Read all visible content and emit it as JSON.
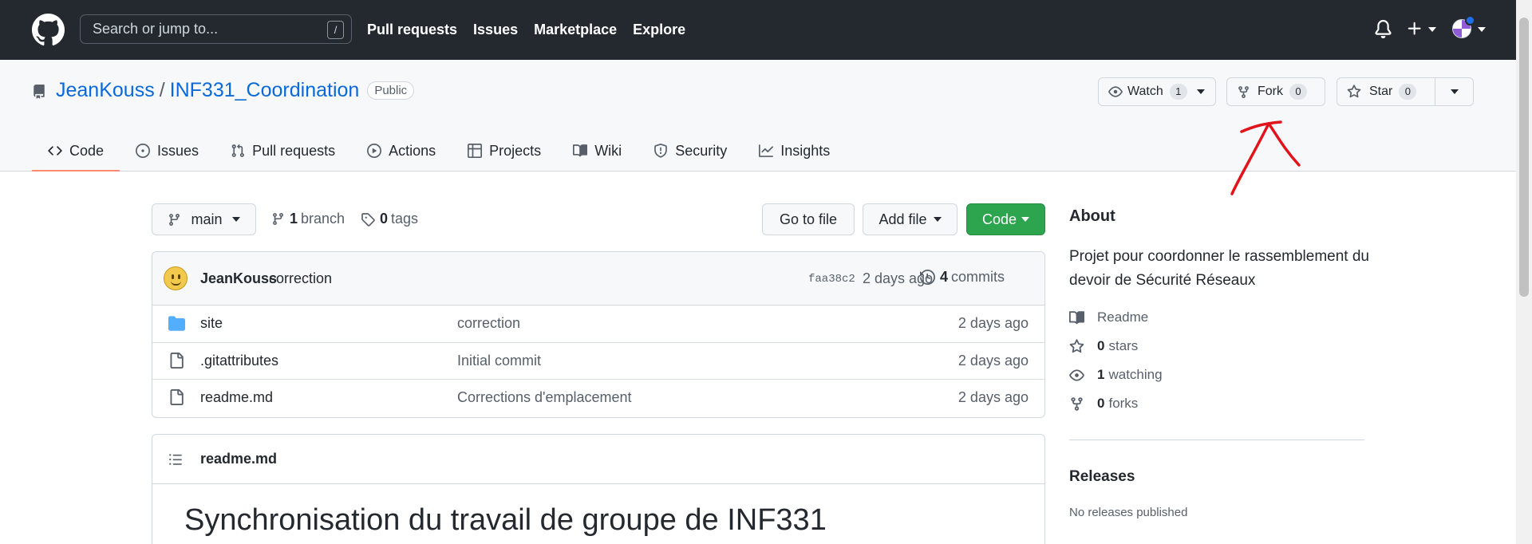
{
  "topbar": {
    "search_placeholder": "Search or jump to...",
    "search_shortcut": "/",
    "nav": [
      "Pull requests",
      "Issues",
      "Marketplace",
      "Explore"
    ],
    "icons": [
      "github-mark-icon",
      "bell-icon",
      "plus-icon",
      "avatar"
    ]
  },
  "repo": {
    "owner": "JeanKouss",
    "separator": "/",
    "name": "INF331_Coordination",
    "visibility": "Public",
    "watch": {
      "label": "Watch",
      "count": "1"
    },
    "fork": {
      "label": "Fork",
      "count": "0"
    },
    "star": {
      "label": "Star",
      "count": "0"
    }
  },
  "tabs": [
    {
      "label": "Code",
      "icon": "code-icon",
      "active": true
    },
    {
      "label": "Issues",
      "icon": "issue-icon"
    },
    {
      "label": "Pull requests",
      "icon": "pull-request-icon"
    },
    {
      "label": "Actions",
      "icon": "play-icon"
    },
    {
      "label": "Projects",
      "icon": "table-icon"
    },
    {
      "label": "Wiki",
      "icon": "book-icon"
    },
    {
      "label": "Security",
      "icon": "shield-icon"
    },
    {
      "label": "Insights",
      "icon": "graph-icon"
    }
  ],
  "toolbar": {
    "branch": "main",
    "branch_count": "1",
    "branch_label": "branch",
    "tag_count": "0",
    "tag_label": "tags",
    "go_to_file": "Go to file",
    "add_file": "Add file",
    "code": "Code"
  },
  "latest_commit": {
    "author": "JeanKouss",
    "message": "correction",
    "sha": "faa38c2",
    "time": "2 days ago",
    "commit_count": "4",
    "commit_label": "commits"
  },
  "files": [
    {
      "name": "site",
      "type": "folder",
      "message": "correction",
      "age": "2 days ago"
    },
    {
      "name": ".gitattributes",
      "type": "file",
      "message": "Initial commit",
      "age": "2 days ago"
    },
    {
      "name": "readme.md",
      "type": "file",
      "message": "Corrections d'emplacement",
      "age": "2 days ago"
    }
  ],
  "readme": {
    "filename": "readme.md",
    "heading": "Synchronisation du travail de groupe de INF331"
  },
  "about": {
    "title": "About",
    "description": "Projet pour coordonner le rassemblement du devoir de Sécurité Réseaux",
    "readme": "Readme",
    "stars_count": "0",
    "stars_label": "stars",
    "watching_count": "1",
    "watching_label": "watching",
    "forks_count": "0",
    "forks_label": "forks"
  },
  "releases": {
    "title": "Releases",
    "empty": "No releases published"
  },
  "colors": {
    "header_bg": "#24292f",
    "link": "#0969da",
    "green_button": "#2da44e",
    "active_tab_underline": "#fd8c73",
    "annotation": "#e0141a"
  }
}
